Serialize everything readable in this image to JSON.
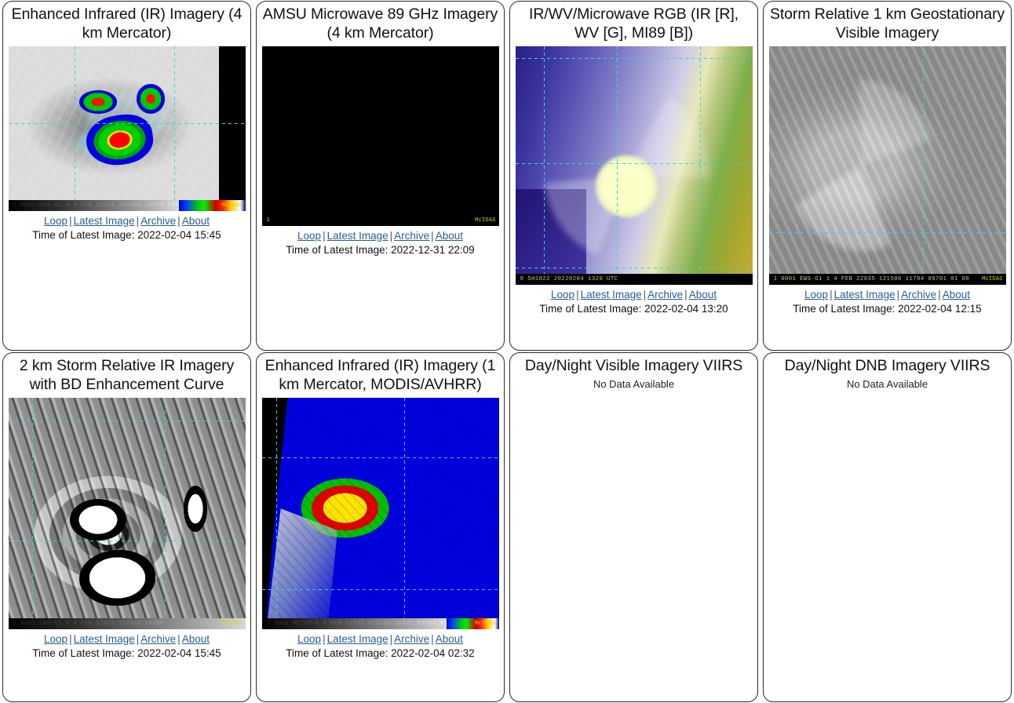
{
  "common": {
    "links": {
      "loop": "Loop",
      "latest": "Latest Image",
      "archive": "Archive",
      "about": "About"
    },
    "separator": "|",
    "time_prefix": "Time of Latest Image:",
    "no_data": "No Data Available",
    "link_color": "#2a5d94",
    "border_color": "#2b2b2b"
  },
  "panels": [
    {
      "id": "enhanced-ir-4km",
      "title": "Enhanced Infrared (IR) Imagery (4 km Mercator)",
      "has_image": true,
      "time_label": "Time of Latest Image: 2022-02-04 15:45",
      "overlay_text": "1 0001 EWS-G1      4   4 FEB 22035 154500 10329 09720 01 00",
      "overlay_brand": "McIDAS"
    },
    {
      "id": "amsu-microwave-89ghz",
      "title": "AMSU Microwave 89 GHz Imagery (4 km Mercator)",
      "has_image": true,
      "time_label": "Time of Latest Image: 2022-12-31 22:09",
      "overlay_text": "1",
      "overlay_brand": "McIDAS"
    },
    {
      "id": "ir-wv-microwave-rgb",
      "title": "IR/WV/Microwave RGB (IR [R], WV [G], MI89 [B])",
      "has_image": true,
      "time_label": "Time of Latest Image: 2022-02-04 13:20",
      "overlay_text": "9      SH1022  20220204  1320 UTC",
      "overlay_brand": ""
    },
    {
      "id": "storm-relative-1km-vis",
      "title": "Storm Relative 1 km Geostationary Visible Imagery",
      "has_image": true,
      "time_label": "Time of Latest Image: 2022-02-04 12:15",
      "overlay_text": "1 0001 EWS-G1      1   4 FEB 22035 121500 11794 09701 01 00",
      "overlay_brand": "McIDAS"
    },
    {
      "id": "storm-relative-2km-ir-bd",
      "title": "2 km Storm Relative IR Imagery with BD Enhancement Curve",
      "has_image": true,
      "time_label": "Time of Latest Image: 2022-02-04 15:45",
      "overlay_text": "1 0001 EWS-G1      4   4 FEB 22035 154500 10399",
      "overlay_brand": "McIDAS"
    },
    {
      "id": "enhanced-ir-1km-modis-avhrr",
      "title": "Enhanced Infrared (IR) Imagery (1 km Mercator, MODIS/AVHRR)",
      "has_image": true,
      "time_label": "Time of Latest Image: 2022-02-04 02:32",
      "overlay_text": "1 0001 METOP-B     4 FEB 22035 023200 11421 09504 01 00",
      "overlay_brand": "McIDAS"
    },
    {
      "id": "day-night-visible-viirs",
      "title": "Day/Night Visible Imagery VIIRS",
      "has_image": false,
      "no_data": "No Data Available"
    },
    {
      "id": "day-night-dnb-viirs",
      "title": "Day/Night DNB Imagery VIIRS",
      "has_image": false,
      "no_data": "No Data Available"
    }
  ]
}
